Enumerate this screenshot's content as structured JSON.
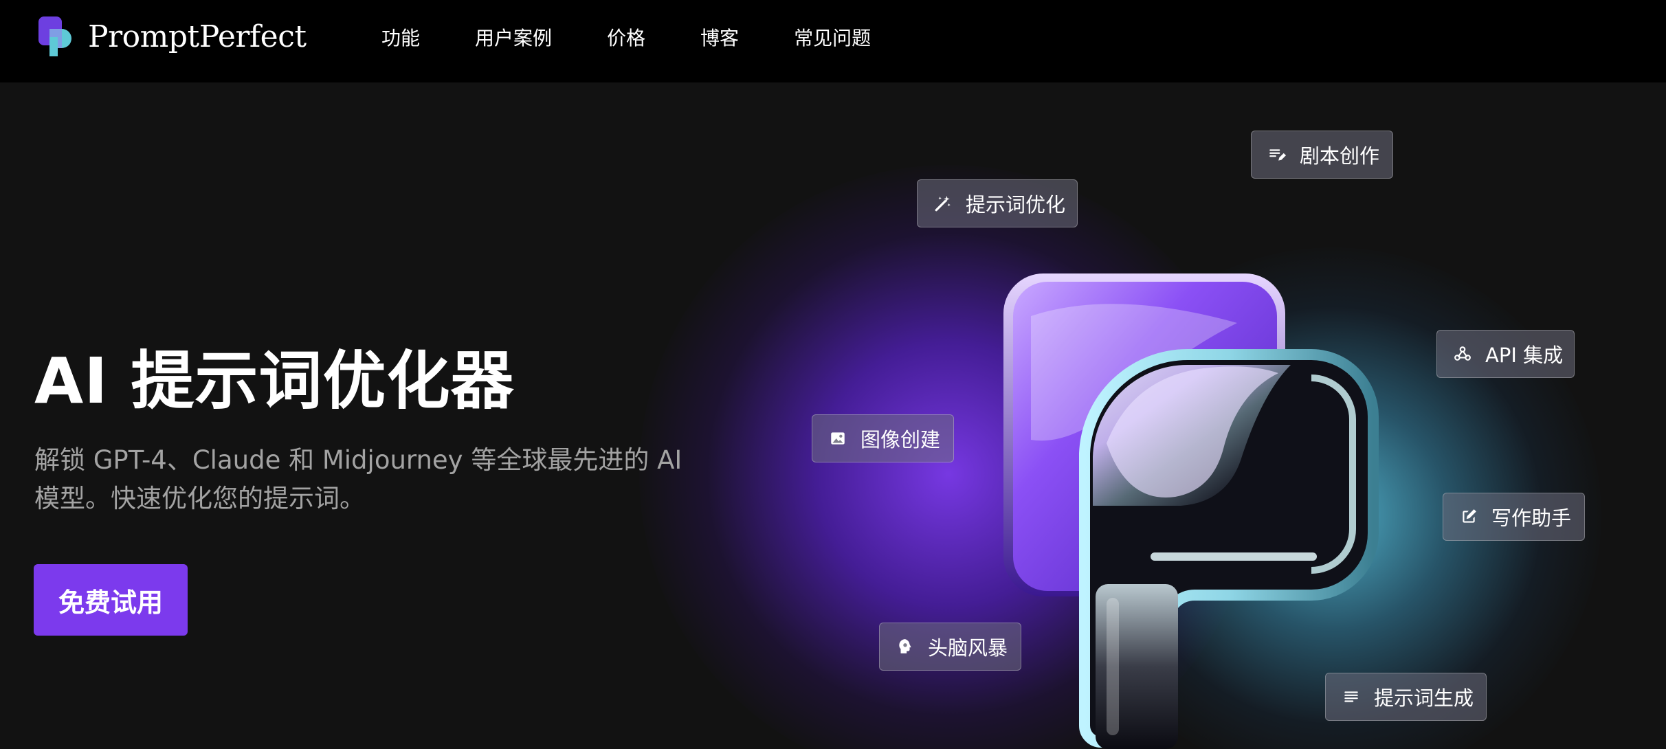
{
  "nav": {
    "brand_name": "PromptPerfect",
    "links": [
      {
        "label": "功能"
      },
      {
        "label": "用户案例"
      },
      {
        "label": "价格"
      },
      {
        "label": "博客"
      },
      {
        "label": "常见问题"
      }
    ]
  },
  "hero": {
    "title": "AI 提示词优化器",
    "subtitle": "解锁 GPT-4、Claude 和 Midjourney 等全球最先进的 AI 模型。快速优化您的提示词。",
    "cta_label": "免费试用"
  },
  "chips": {
    "script_writing": {
      "label": "剧本创作",
      "icon": "notes-edit-icon"
    },
    "prompt_optimize": {
      "label": "提示词优化",
      "icon": "magic-wand-icon"
    },
    "api": {
      "label": "API 集成",
      "icon": "webhook-icon"
    },
    "image": {
      "label": "图像创建",
      "icon": "image-icon"
    },
    "writing": {
      "label": "写作助手",
      "icon": "pencil-square-icon"
    },
    "brainstorm": {
      "label": "头脑风暴",
      "icon": "brain-head-icon"
    },
    "prompt_gen": {
      "label": "提示词生成",
      "icon": "lines-list-icon"
    }
  },
  "colors": {
    "accent": "#7c3aed",
    "glow_cyan": "#5ac8e6",
    "background": "#121212",
    "nav_background": "#000000"
  }
}
